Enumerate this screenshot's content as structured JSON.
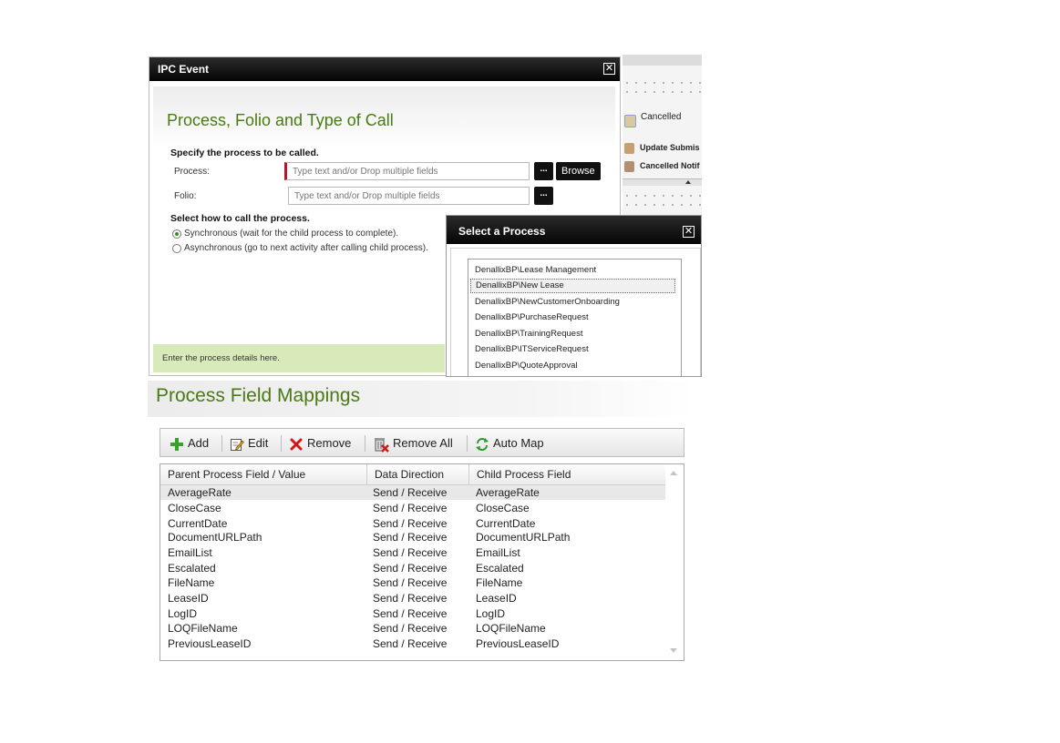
{
  "background": {
    "items": [
      {
        "label": "Cancelled"
      },
      {
        "label": "Update Submis"
      },
      {
        "label": "Cancelled Notif"
      }
    ]
  },
  "ipc_dialog": {
    "title": "IPC Event",
    "section_title": "Process, Folio and Type of Call",
    "specify_label": "Specify the process to be called.",
    "process_label": "Process:",
    "process_placeholder": "Type text and/or Drop multiple fields",
    "folio_label": "Folio:",
    "folio_placeholder": "Type text and/or Drop multiple fields",
    "ellipsis_label": "...",
    "browse_label": "Browse",
    "call_type_label": "Select how to call the process.",
    "options": [
      {
        "label": "Synchronous (wait for the child process to complete).",
        "checked": true
      },
      {
        "label": "Asynchronous (go to next activity after calling child process).",
        "checked": false
      }
    ],
    "hint": "Enter the process details here."
  },
  "select_process_dialog": {
    "title": "Select a Process",
    "processes": [
      "DenallixBP\\Lease Management",
      "DenallixBP\\New Lease",
      "DenallixBP\\NewCustomerOnboarding",
      "DenallixBP\\PurchaseRequest",
      "DenallixBP\\TrainingRequest",
      "DenallixBP\\ITServiceRequest",
      "DenallixBP\\QuoteApproval"
    ],
    "selected_index": 1
  },
  "field_mappings": {
    "title": "Process Field Mappings",
    "toolbar": {
      "add": "Add",
      "edit": "Edit",
      "remove": "Remove",
      "remove_all": "Remove All",
      "auto_map": "Auto Map"
    },
    "columns": [
      "Parent Process Field / Value",
      "Data Direction",
      "Child Process Field"
    ],
    "rows": [
      [
        "AverageRate",
        "Send / Receive",
        "AverageRate"
      ],
      [
        "CloseCase",
        "Send / Receive",
        "CloseCase"
      ],
      [
        "CurrentDate",
        "Send / Receive",
        "CurrentDate"
      ],
      [
        "DocumentURLPath",
        "Send / Receive",
        "DocumentURLPath"
      ],
      [
        "EmailList",
        "Send / Receive",
        "EmailList"
      ],
      [
        "Escalated",
        "Send / Receive",
        "Escalated"
      ],
      [
        "FileName",
        "Send / Receive",
        "FileName"
      ],
      [
        "LeaseID",
        "Send / Receive",
        "LeaseID"
      ],
      [
        "LogID",
        "Send / Receive",
        "LogID"
      ],
      [
        "LOQFileName",
        "Send / Receive",
        "LOQFileName"
      ],
      [
        "PreviousLeaseID",
        "Send / Receive",
        "PreviousLeaseID"
      ]
    ],
    "selected_row": 0
  },
  "colors": {
    "accent_green": "#4a7a14",
    "hint_bg": "#d8eab9",
    "required_marker": "#b01a2a"
  }
}
